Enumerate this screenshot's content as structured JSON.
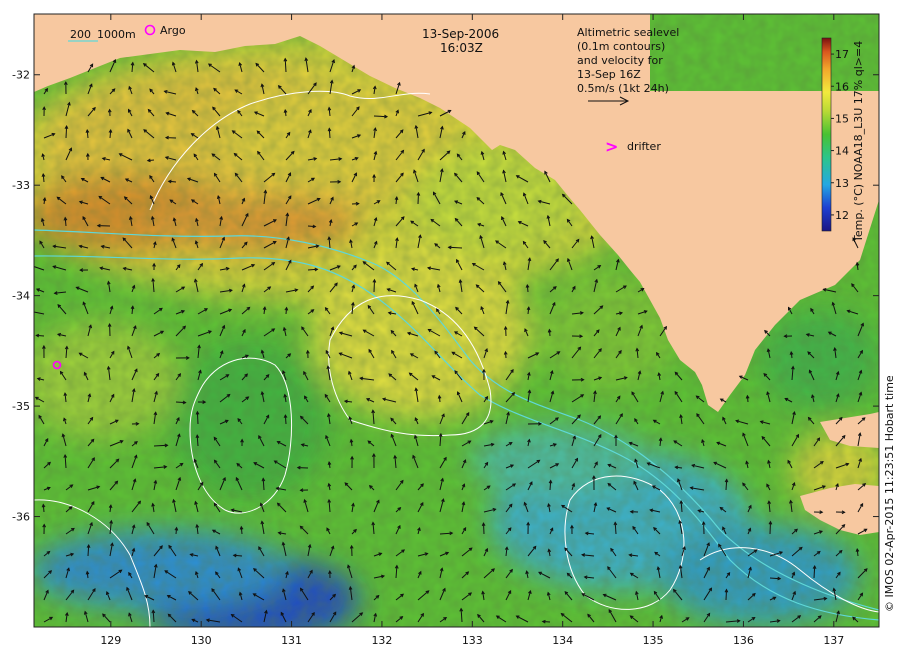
{
  "map": {
    "title_date": "13-Sep-2006",
    "title_time": "16:03Z",
    "contour_label_a": "200",
    "contour_label_b": "1000m",
    "argo_label": "Argo",
    "drifter_label": "drifter",
    "drifter_glyph": ">",
    "altimetry_lines": [
      "Altimetric sealevel",
      "(0.1m contours)",
      "and velocity for",
      "13-Sep 16Z",
      "0.5m/s (1kt 24h)"
    ],
    "colorbar_label": "Temp. (°C) NOAA18_L3U 17% ql>=4",
    "credit": "© IMOS 02-Apr-2015 11:23:51 Hobart time",
    "x_ticks": [
      "129",
      "130",
      "131",
      "132",
      "133",
      "134",
      "135",
      "136",
      "137"
    ],
    "y_ticks": [
      "-32",
      "-33",
      "-34",
      "-35",
      "-36"
    ],
    "colorbar_ticks": [
      "12",
      "13",
      "14",
      "15",
      "16",
      "17"
    ],
    "colorbar_range": [
      11.5,
      17.5
    ],
    "lon_range": [
      128.15,
      137.5
    ],
    "lat_range": [
      -37.0,
      -31.45
    ],
    "colors": {
      "land": "#f7c8a0",
      "contour_200m": "#5fd8d8",
      "sealevel_contour": "#ffffff",
      "arrow": "#111111",
      "argo": "#ff00ff",
      "drifter": "#ff00ff"
    }
  }
}
